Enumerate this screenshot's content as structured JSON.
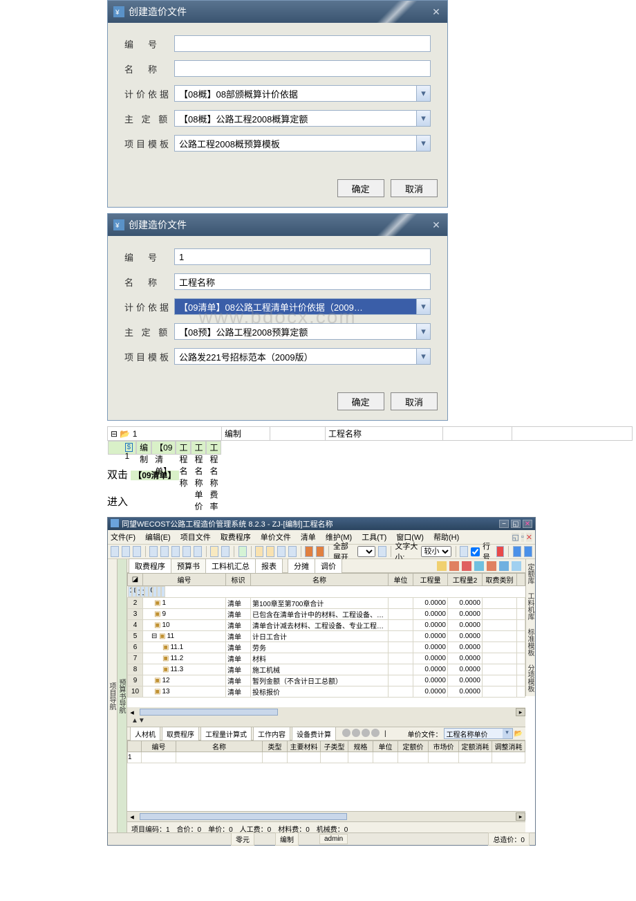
{
  "dialog1": {
    "title": "创建造价文件",
    "labels": {
      "no": "编　号",
      "name": "名　称",
      "basis": "计价依据",
      "main": "主 定 额",
      "tmpl": "项目模板"
    },
    "values": {
      "no": "",
      "name": "",
      "basis": "【08概】08部颁概算计价依据",
      "main": "【08概】公路工程2008概算定额",
      "tmpl": "公路工程2008概预算模板"
    },
    "ok": "确定",
    "cancel": "取消"
  },
  "dialog2": {
    "title": "创建造价文件",
    "labels": {
      "no": "编　号",
      "name": "名　称",
      "basis": "计价依据",
      "main": "主 定 额",
      "tmpl": "项目模板"
    },
    "values": {
      "no": "1",
      "name": "工程名称",
      "basis": "【09清单】08公路工程清单计价依据（2009…",
      "main": "【08预】公路工程2008预算定额",
      "tmpl": "公路发221号招标范本（2009版）"
    },
    "ok": "确定",
    "cancel": "取消"
  },
  "tree": {
    "row1": {
      "no": "1",
      "status": "编制",
      "tag": "",
      "proj": "工程名称",
      "up": "",
      "rate": ""
    },
    "row2": {
      "no": "1",
      "status": "编制",
      "tag": "【09清单】",
      "proj": "工程名称",
      "up": "工程名称单价",
      "rate": "工程名称费率"
    }
  },
  "dbltxt": "双击",
  "dbltag": "【09清单】",
  "enter": "进入",
  "app": {
    "title": "同望WECOST公路工程造价管理系统 8.2.3 - ZJ-[编制]工程名称",
    "menu": {
      "file": "文件(F)",
      "edit": "编辑(E)",
      "proj": "项目文件",
      "fee": "取费程序",
      "unit": "单价文件",
      "list": "清单",
      "maint": "维护(M)",
      "tool": "工具(T)",
      "win": "窗口(W)",
      "help": "帮助(H)"
    },
    "tb": {
      "expand": "全部展开",
      "fontsz": "文字大小:",
      "fontval": "较小",
      "rowno": "行号"
    },
    "subtabs": {
      "fee": "取费程序",
      "budget": "预算书",
      "sum": "工料机汇总",
      "rpt": "报表",
      "split": "分摊",
      "adj": "调价"
    },
    "vtableft": "项目导航",
    "vtableft2": "预算书导航",
    "vtabright": [
      "定额库",
      "工料机库",
      "标准模板",
      "分项模板"
    ],
    "gridcols": {
      "no": "编号",
      "mark": "标识",
      "name": "名称",
      "unit": "单位",
      "qty1": "工程量",
      "qty2": "工程量2",
      "feecat": "取费类别"
    },
    "rows": [
      {
        "n": "1",
        "no": "1",
        "mark": "工程",
        "name": "工程名称",
        "qty1": "0.0000",
        "qty2": ""
      },
      {
        "n": "2",
        "no": "1",
        "mark": "清单",
        "name": "第100章至第700章合计",
        "qty1": "0.0000",
        "qty2": "0.0000"
      },
      {
        "n": "3",
        "no": "9",
        "mark": "清单",
        "name": "已包含在清单合计中的材料、工程设备、…",
        "qty1": "0.0000",
        "qty2": "0.0000"
      },
      {
        "n": "4",
        "no": "10",
        "mark": "清单",
        "name": "清单合计减去材料、工程设备、专业工程…",
        "qty1": "0.0000",
        "qty2": "0.0000"
      },
      {
        "n": "5",
        "no": "11",
        "mark": "清单",
        "name": "计日工合计",
        "qty1": "0.0000",
        "qty2": "0.0000"
      },
      {
        "n": "6",
        "no": "11.1",
        "mark": "清单",
        "name": "劳务",
        "qty1": "0.0000",
        "qty2": "0.0000"
      },
      {
        "n": "7",
        "no": "11.2",
        "mark": "清单",
        "name": "材料",
        "qty1": "0.0000",
        "qty2": "0.0000"
      },
      {
        "n": "8",
        "no": "11.3",
        "mark": "清单",
        "name": "施工机械",
        "qty1": "0.0000",
        "qty2": "0.0000"
      },
      {
        "n": "9",
        "no": "12",
        "mark": "清单",
        "name": "暂列金额（不含计日工总额）",
        "qty1": "0.0000",
        "qty2": "0.0000"
      },
      {
        "n": "10",
        "no": "13",
        "mark": "清单",
        "name": "投标报价",
        "qty1": "0.0000",
        "qty2": "0.0000"
      }
    ],
    "lowtabs": {
      "rcj": "人材机",
      "fee": "取费程序",
      "qty": "工程量计算式",
      "work": "工作内容",
      "dev": "设备费计算",
      "upfile": "单价文件：",
      "upval": "工程名称单价"
    },
    "lowcols": {
      "no": "编号",
      "name": "名称",
      "type": "类型",
      "mainmat": "主要材料",
      "subtype": "子类型",
      "spec": "规格",
      "unit": "单位",
      "dprice": "定额价",
      "mprice": "市场价",
      "duse": "定额消耗",
      "ause": "调整消耗"
    },
    "status": "项目编码：1　合价：0　单价：0　人工费：0　材料费：0　机械费：0",
    "bar": {
      "amt": "零元",
      "mode": "编制",
      "user": "admin",
      "total": "总造价：0"
    }
  }
}
